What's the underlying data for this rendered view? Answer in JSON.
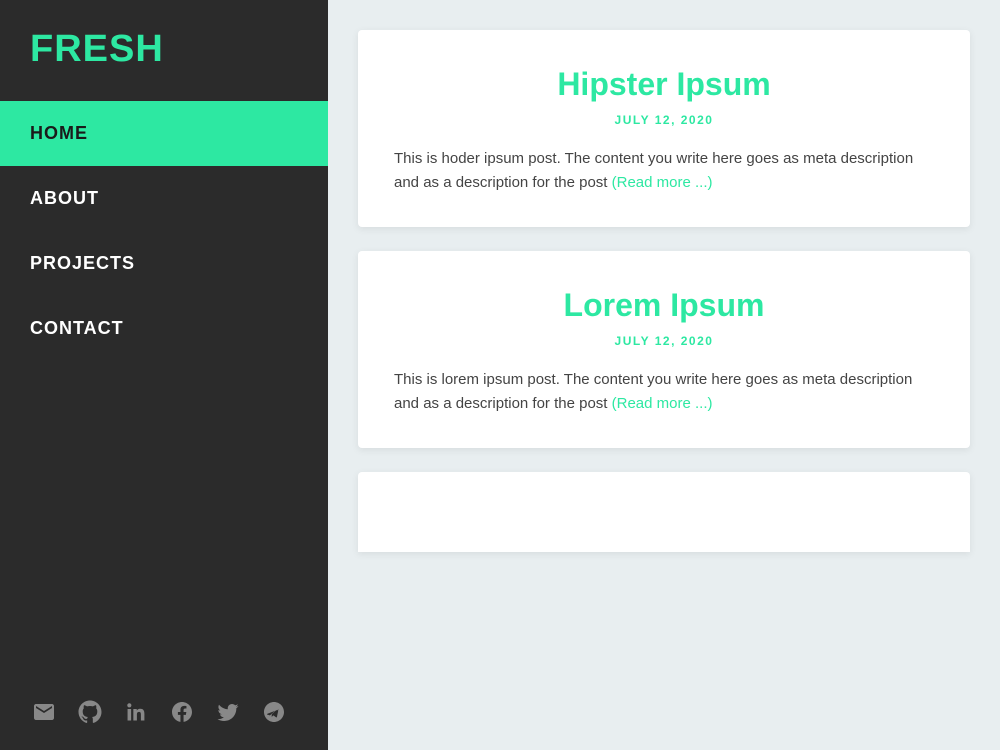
{
  "sidebar": {
    "logo": "FRESH",
    "nav": [
      {
        "label": "HOME",
        "active": true
      },
      {
        "label": "ABOUT",
        "active": false
      },
      {
        "label": "PROJECTS",
        "active": false
      },
      {
        "label": "CONTACT",
        "active": false
      }
    ],
    "social_icons": [
      {
        "name": "email-icon",
        "title": "Email"
      },
      {
        "name": "github-icon",
        "title": "GitHub"
      },
      {
        "name": "linkedin-icon",
        "title": "LinkedIn"
      },
      {
        "name": "facebook-icon",
        "title": "Facebook"
      },
      {
        "name": "twitter-icon",
        "title": "Twitter"
      },
      {
        "name": "telegram-icon",
        "title": "Telegram"
      }
    ]
  },
  "posts": [
    {
      "title": "Hipster Ipsum",
      "date": "JULY 12, 2020",
      "excerpt": "This is hoder ipsum post. The content you write here goes as meta description and as a description for the post",
      "read_more": "(Read more ...)"
    },
    {
      "title": "Lorem Ipsum",
      "date": "JULY 12, 2020",
      "excerpt": "This is lorem ipsum post. The content you write here goes as meta description and as a description for the post",
      "read_more": "(Read more ...)"
    }
  ]
}
